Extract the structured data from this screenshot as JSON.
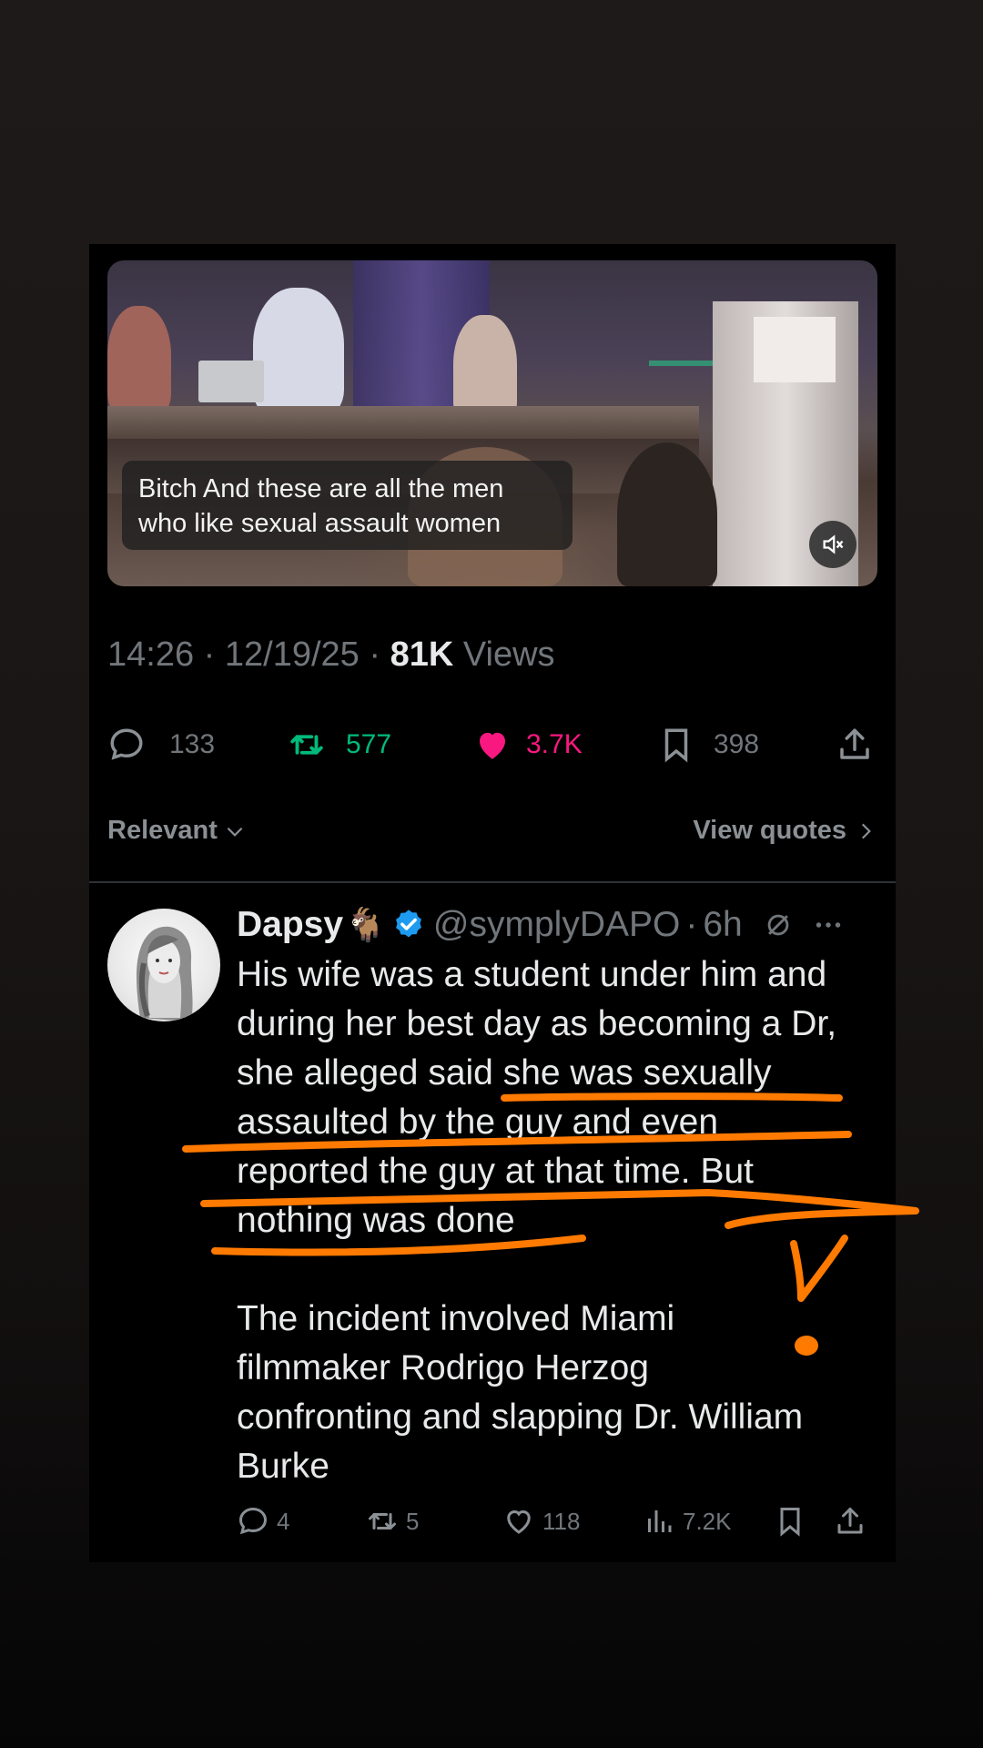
{
  "video": {
    "caption_line1": "Bitch And these are all the men",
    "caption_line2": "who like sexual assault women",
    "mute_icon": "volume-mute-icon"
  },
  "meta": {
    "time": "14:26",
    "sep1": " · ",
    "date": "12/19/25",
    "sep2": " · ",
    "views_count": "81K",
    "views_label": " Views"
  },
  "actions": {
    "replies": "133",
    "reposts": "577",
    "likes": "3.7K",
    "bookmarks": "398",
    "repost_color": "#00ba7c",
    "like_color": "#f91880"
  },
  "filter": {
    "sort_label": "Relevant",
    "view_quotes": "View quotes"
  },
  "reply": {
    "name": "Dapsy",
    "name_emoji": "🐐",
    "handle": "@symplyDAPO",
    "dot": "·",
    "age": "6h",
    "verified_color": "#1d9bf0",
    "lines": [
      "His wife was a student under him and",
      "during her best day as becoming a Dr,",
      "she alleged said she was sexually",
      "assaulted by the guy and even",
      "reported the guy at that time.  But",
      "nothing was done"
    ],
    "lines2": [
      "The incident involved Miami",
      "filmmaker Rodrigo Herzog",
      "confronting and slapping Dr. William",
      "Burke"
    ],
    "stats": {
      "replies": "4",
      "reposts": "5",
      "likes": "118",
      "views": "7.2K"
    }
  },
  "annotation_color": "#ff7a00"
}
